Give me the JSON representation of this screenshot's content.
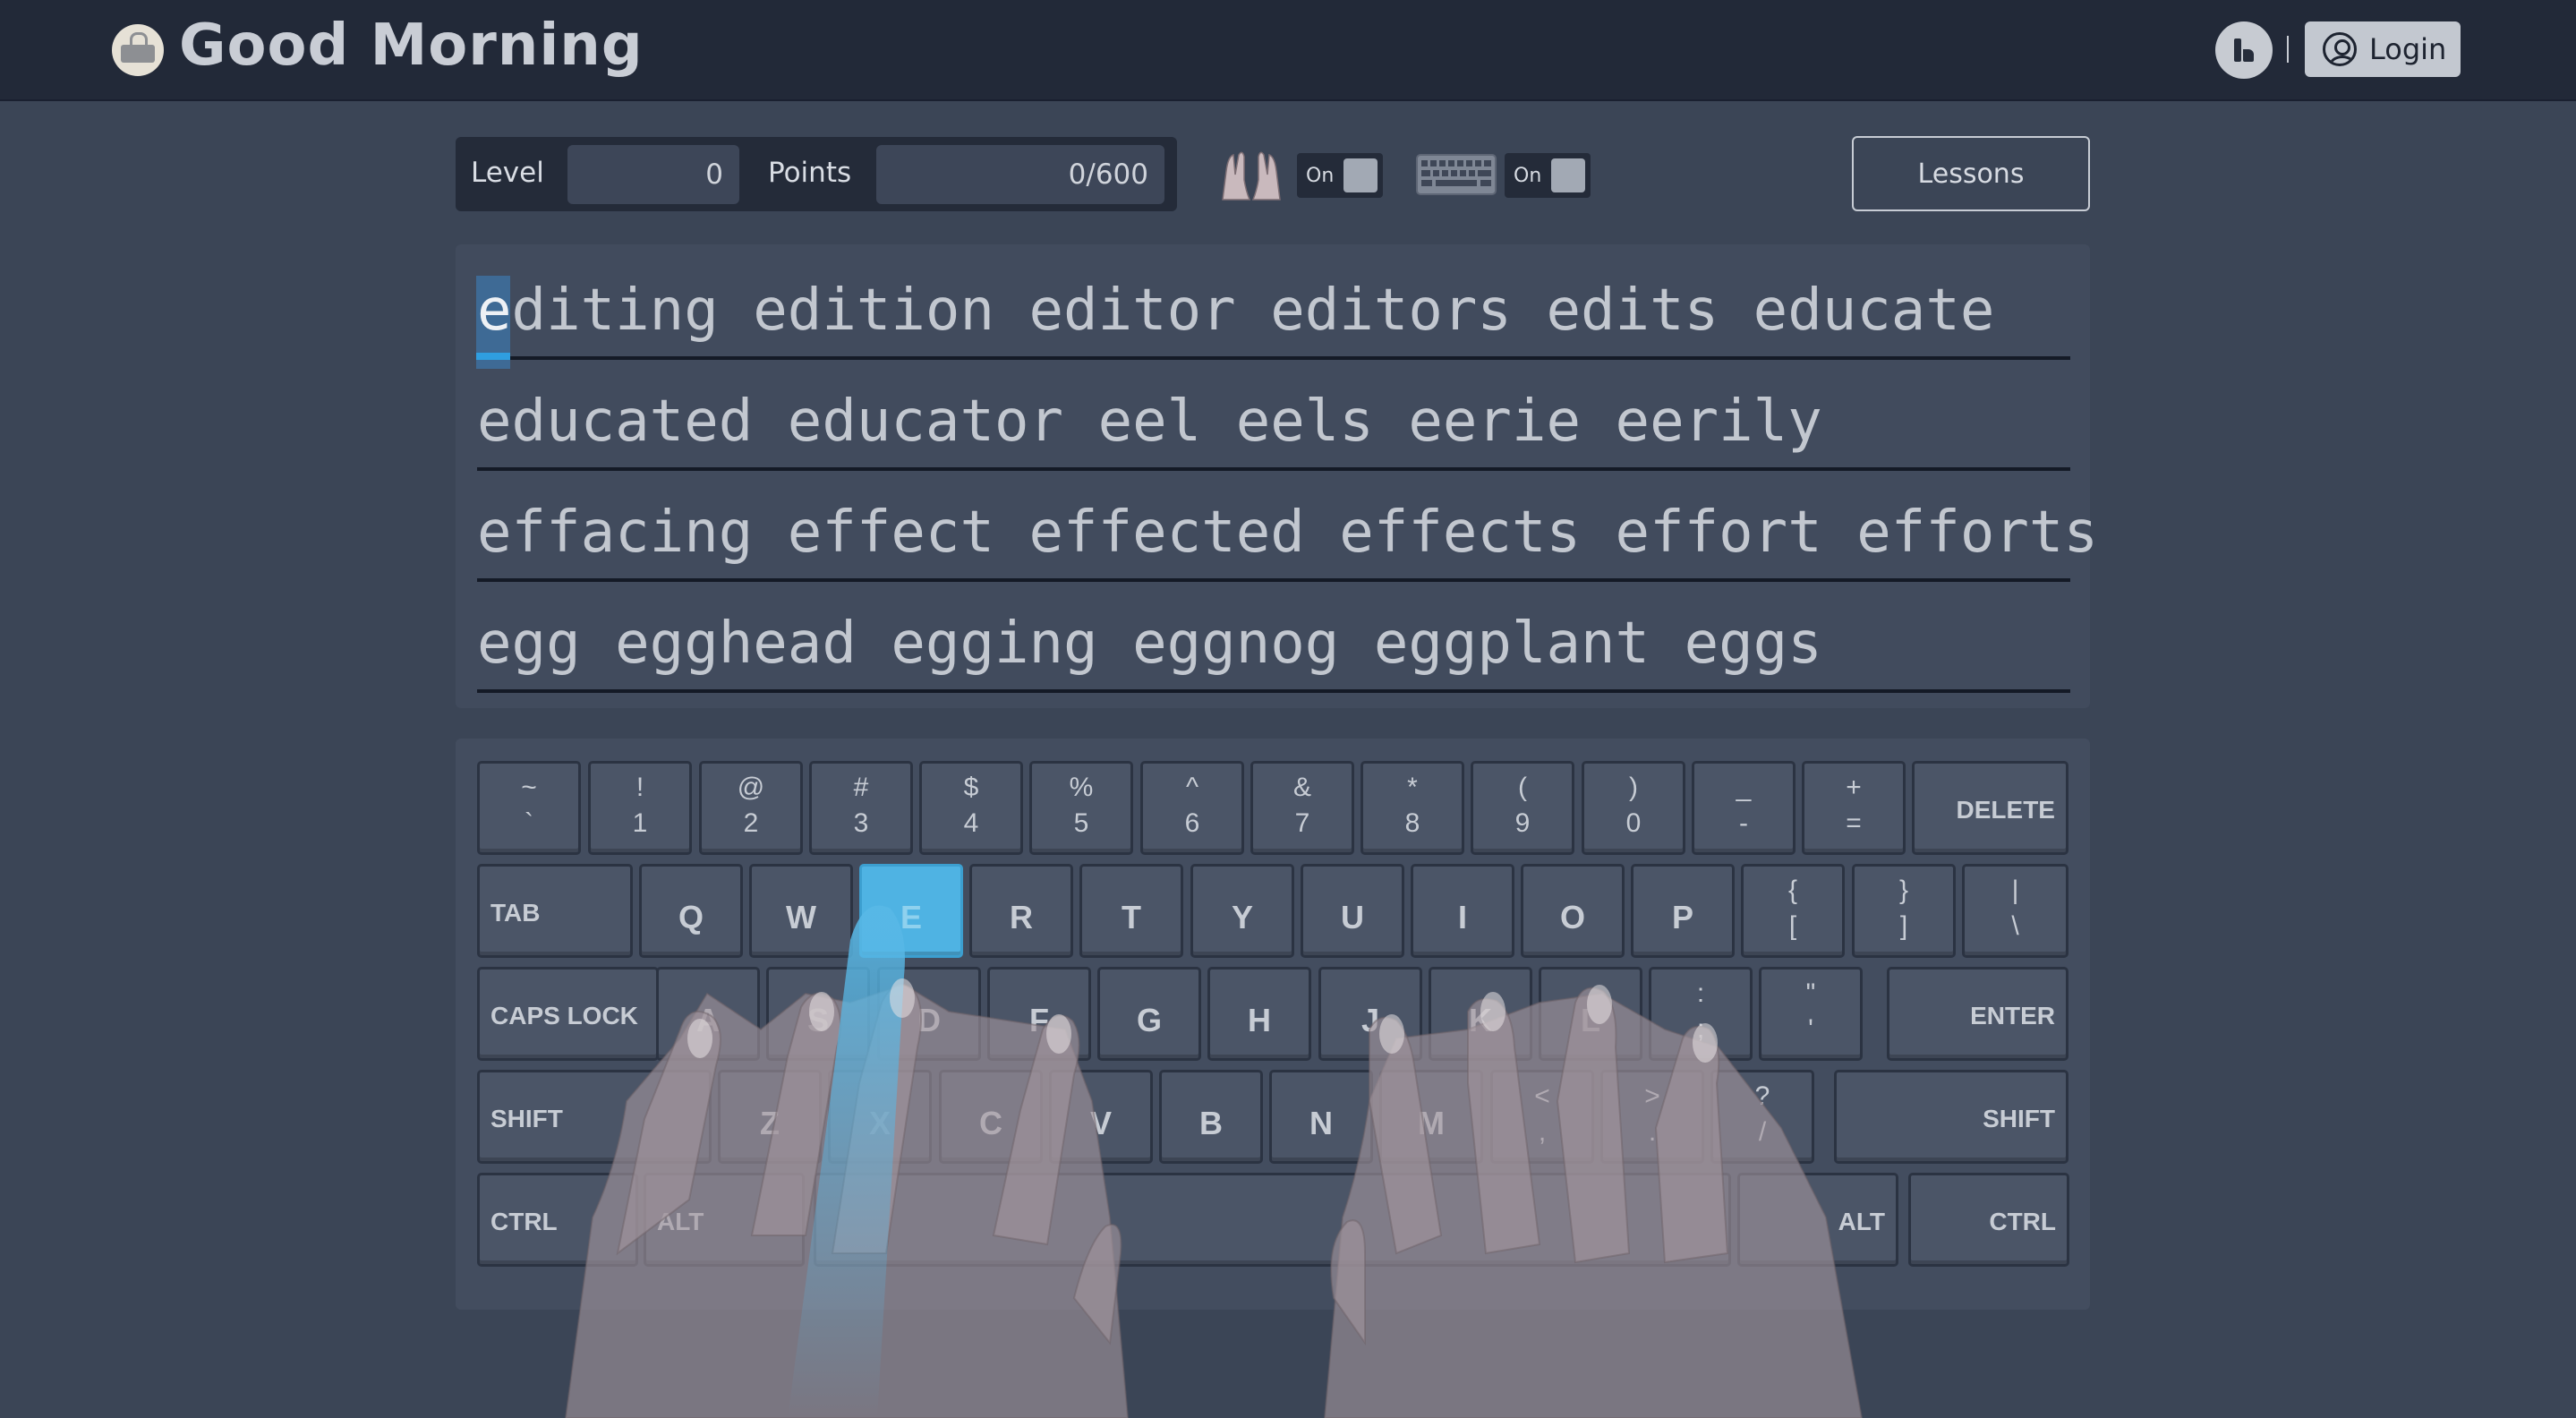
{
  "header": {
    "app_title": "Good Morning",
    "login_label": "Login"
  },
  "stats": {
    "level_label": "Level",
    "level_value": "0",
    "points_label": "Points",
    "points_value": "0/600",
    "hands_toggle_label": "On",
    "keyboard_toggle_label": "On",
    "lessons_label": "Lessons"
  },
  "practice": {
    "current_char": "e",
    "lines": [
      "editing edition editor editors edits educate",
      "educated educator eel eels eerie eerily",
      "effacing effect effected effects effort efforts",
      "egg egghead egging eggnog eggplant eggs"
    ]
  },
  "keyboard": {
    "active_key": "E",
    "row1": [
      {
        "top": "~",
        "bot": "`"
      },
      {
        "top": "!",
        "bot": "1"
      },
      {
        "top": "@",
        "bot": "2"
      },
      {
        "top": "#",
        "bot": "3"
      },
      {
        "top": "$",
        "bot": "4"
      },
      {
        "top": "%",
        "bot": "5"
      },
      {
        "top": "^",
        "bot": "6"
      },
      {
        "top": "&",
        "bot": "7"
      },
      {
        "top": "*",
        "bot": "8"
      },
      {
        "top": "(",
        "bot": "9"
      },
      {
        "top": ")",
        "bot": "0"
      },
      {
        "top": "_",
        "bot": "-"
      },
      {
        "top": "+",
        "bot": "="
      },
      {
        "label": "DELETE"
      }
    ],
    "row2": [
      {
        "label": "TAB"
      },
      {
        "mid": "Q"
      },
      {
        "mid": "W"
      },
      {
        "mid": "E"
      },
      {
        "mid": "R"
      },
      {
        "mid": "T"
      },
      {
        "mid": "Y"
      },
      {
        "mid": "U"
      },
      {
        "mid": "I"
      },
      {
        "mid": "O"
      },
      {
        "mid": "P"
      },
      {
        "top": "{",
        "bot": "["
      },
      {
        "top": "}",
        "bot": "]"
      },
      {
        "top": "|",
        "bot": "\\"
      }
    ],
    "row3": [
      {
        "label": "CAPS LOCK"
      },
      {
        "mid": "A"
      },
      {
        "mid": "S"
      },
      {
        "mid": "D"
      },
      {
        "mid": "F"
      },
      {
        "mid": "G"
      },
      {
        "mid": "H"
      },
      {
        "mid": "J"
      },
      {
        "mid": "K"
      },
      {
        "mid": "L"
      },
      {
        "top": ":",
        "bot": ";"
      },
      {
        "top": "\"",
        "bot": "'"
      },
      {
        "label": "ENTER"
      }
    ],
    "row4": [
      {
        "label": "SHIFT"
      },
      {
        "mid": "Z"
      },
      {
        "mid": "X"
      },
      {
        "mid": "C"
      },
      {
        "mid": "V"
      },
      {
        "mid": "B"
      },
      {
        "mid": "N"
      },
      {
        "mid": "M"
      },
      {
        "top": "<",
        "bot": ","
      },
      {
        "top": ">",
        "bot": "."
      },
      {
        "top": "?",
        "bot": "/"
      },
      {
        "label": "SHIFT"
      }
    ],
    "row5": [
      {
        "label": "CTRL"
      },
      {
        "label": "ALT"
      },
      {
        "label": ""
      },
      {
        "label": "ALT"
      },
      {
        "label": "CTRL"
      }
    ]
  },
  "icons": {
    "hands_toggle": "hands-icon",
    "keyboard_toggle": "keyboard-icon",
    "account": "user-circle-icon",
    "app_logo": "typewriter-logo-icon"
  },
  "colors": {
    "background": "#3b4556",
    "header": "#222938",
    "active_key": "#4fb3e3",
    "cursor_underline": "#2f9ee0"
  }
}
